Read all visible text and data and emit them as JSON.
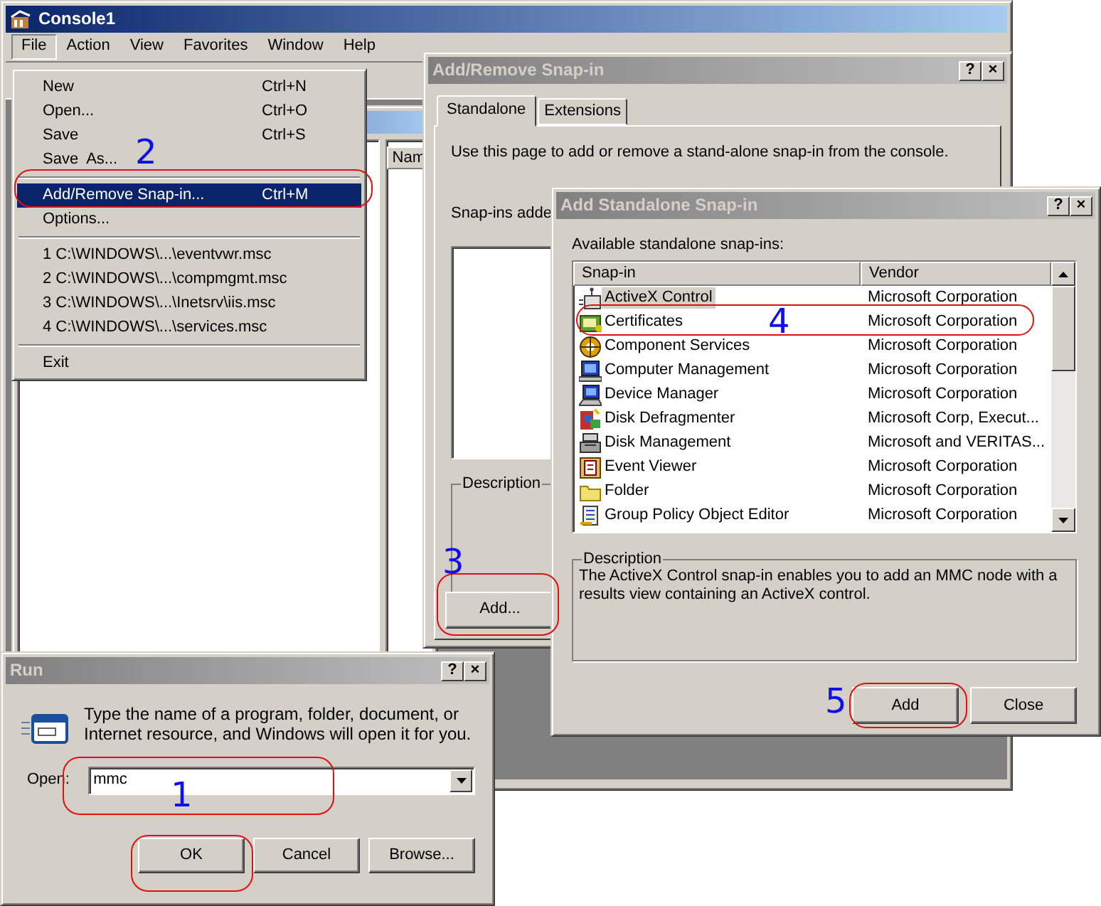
{
  "console": {
    "title": "Console1",
    "active": true,
    "menu": [
      {
        "label": "File",
        "selected": true
      },
      {
        "label": "Action",
        "selected": false
      },
      {
        "label": "View",
        "selected": false
      },
      {
        "label": "Favorites",
        "selected": false
      },
      {
        "label": "Window",
        "selected": false
      },
      {
        "label": "Help",
        "selected": false
      }
    ],
    "child_column": "Nam"
  },
  "file_menu": {
    "items": [
      {
        "kind": "item",
        "label": "New",
        "shortcut": "Ctrl+N",
        "selected": false
      },
      {
        "kind": "item",
        "label": "Open...",
        "shortcut": "Ctrl+O",
        "selected": false
      },
      {
        "kind": "item",
        "label": "Save",
        "shortcut": "Ctrl+S",
        "selected": false
      },
      {
        "kind": "item",
        "label": "Save  As...",
        "selected": false
      },
      {
        "kind": "separator"
      },
      {
        "kind": "item",
        "label": "Add/Remove Snap-in...",
        "shortcut": "Ctrl+M",
        "selected": true
      },
      {
        "kind": "item",
        "label": "Options...",
        "selected": false
      },
      {
        "kind": "separator"
      },
      {
        "kind": "item",
        "label": "1 C:\\WINDOWS\\...\\eventvwr.msc",
        "selected": false
      },
      {
        "kind": "item",
        "label": "2 C:\\WINDOWS\\...\\compmgmt.msc",
        "selected": false
      },
      {
        "kind": "item",
        "label": "3 C:\\WINDOWS\\...\\Inetsrv\\iis.msc",
        "selected": false
      },
      {
        "kind": "item",
        "label": "4 C:\\WINDOWS\\...\\services.msc",
        "selected": false
      },
      {
        "kind": "separator"
      },
      {
        "kind": "item",
        "label": "Exit",
        "selected": false
      }
    ]
  },
  "add_remove_dialog": {
    "title": "Add/Remove Snap-in",
    "active": false,
    "title_buttons": [
      "?",
      "×"
    ],
    "tabs": [
      {
        "label": "Standalone",
        "selected": true
      },
      {
        "label": "Extensions",
        "selected": false
      }
    ],
    "intro": "Use this page to add or remove a stand-alone snap-in from the console.",
    "list_label": "Snap-ins adde",
    "description_label": "Description",
    "add_button": "Add..."
  },
  "standalone_dialog": {
    "title": "Add Standalone Snap-in",
    "active": false,
    "title_buttons": [
      "?",
      "×"
    ],
    "list_label": "Available standalone snap-ins:",
    "columns": [
      "Snap-in",
      "Vendor"
    ],
    "rows": [
      {
        "name": "ActiveX Control",
        "vendor": "Microsoft Corporation",
        "selected": true
      },
      {
        "name": "Certificates",
        "vendor": "Microsoft Corporation",
        "selected": false
      },
      {
        "name": "Component Services",
        "vendor": "Microsoft Corporation",
        "selected": false
      },
      {
        "name": "Computer Management",
        "vendor": "Microsoft Corporation",
        "selected": false
      },
      {
        "name": "Device Manager",
        "vendor": "Microsoft Corporation",
        "selected": false
      },
      {
        "name": "Disk Defragmenter",
        "vendor": "Microsoft Corp, Execut...",
        "selected": false
      },
      {
        "name": "Disk Management",
        "vendor": "Microsoft and VERITAS...",
        "selected": false
      },
      {
        "name": "Event Viewer",
        "vendor": "Microsoft Corporation",
        "selected": false
      },
      {
        "name": "Folder",
        "vendor": "Microsoft Corporation",
        "selected": false
      },
      {
        "name": "Group Policy Object Editor",
        "vendor": "Microsoft Corporation",
        "selected": false
      }
    ],
    "description_label": "Description",
    "description": "The ActiveX Control snap-in enables you to add an MMC node with a results view containing an ActiveX control.",
    "buttons": [
      "Add",
      "Close"
    ]
  },
  "run_dialog": {
    "title": "Run",
    "active": false,
    "title_buttons": [
      "?",
      "×"
    ],
    "prompt": "Type the name of a program, folder, document, or Internet resource, and Windows will open it for you.",
    "open_label": "Open:",
    "open_value": "mmc",
    "buttons": [
      "OK",
      "Cancel",
      "Browse..."
    ]
  },
  "annotations": [
    {
      "kind": "oval"
    },
    {
      "kind": "oval"
    },
    {
      "kind": "oval"
    },
    {
      "kind": "oval"
    },
    {
      "kind": "oval"
    },
    {
      "kind": "oval"
    },
    {
      "kind": "number",
      "label": "1"
    },
    {
      "kind": "number",
      "label": "2"
    },
    {
      "kind": "number",
      "label": "3"
    },
    {
      "kind": "number",
      "label": "4"
    },
    {
      "kind": "number",
      "label": "5"
    }
  ]
}
